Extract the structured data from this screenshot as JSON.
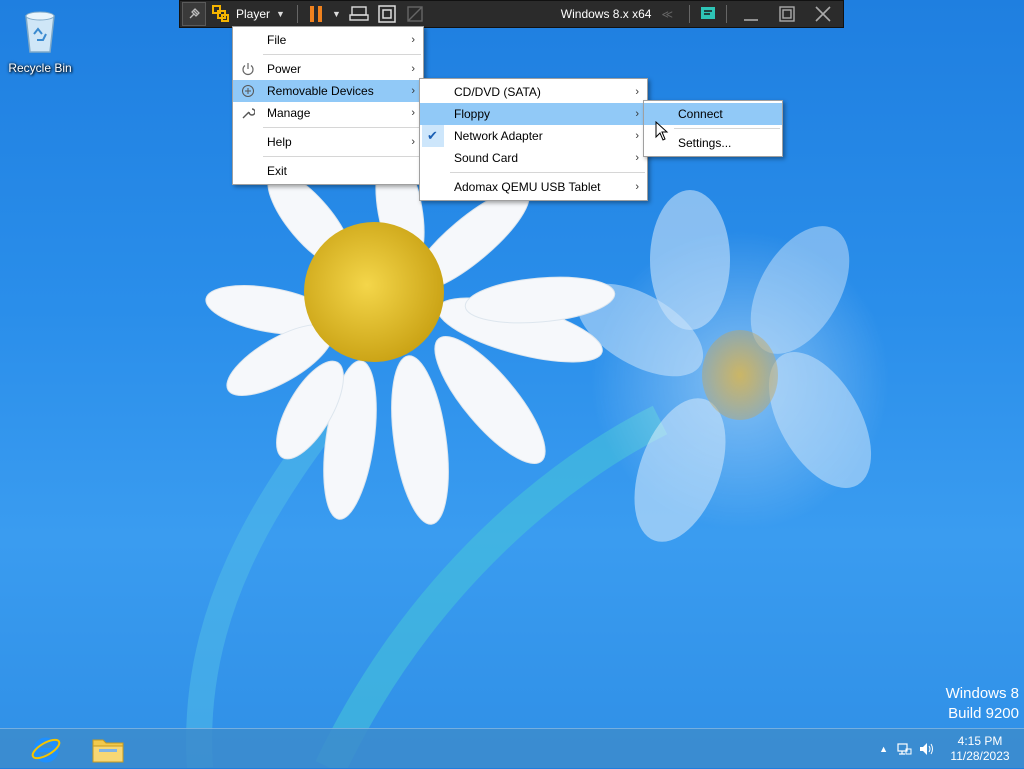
{
  "desktop": {
    "recycle_bin_label": "Recycle Bin"
  },
  "toolbar": {
    "player_label": "Player",
    "vm_name": "Windows 8.x x64",
    "icons": [
      "pin-icon",
      "player-logo-icon",
      "pause-icon",
      "send-ctrl-alt-del-icon",
      "fit-guest-icon",
      "unity-icon",
      "message-log-icon",
      "minimize-icon",
      "restore-icon",
      "close-icon"
    ]
  },
  "main_menu": {
    "items": [
      {
        "label": "File"
      },
      {
        "label": "Power"
      },
      {
        "label": "Removable Devices"
      },
      {
        "label": "Manage"
      },
      {
        "label": "Help"
      },
      {
        "label": "Exit"
      }
    ]
  },
  "devices_menu": {
    "items": [
      {
        "label": "CD/DVD (SATA)"
      },
      {
        "label": "Floppy"
      },
      {
        "label": "Network Adapter"
      },
      {
        "label": "Sound Card"
      },
      {
        "label": "Adomax QEMU USB Tablet"
      }
    ]
  },
  "floppy_menu": {
    "items": [
      {
        "label": "Connect"
      },
      {
        "label": "Settings..."
      }
    ]
  },
  "watermark": {
    "line1": "Windows 8",
    "line2": "Build 9200"
  },
  "taskbar": {
    "time": "4:15 PM",
    "date": "11/28/2023"
  },
  "colors": {
    "highlight": "#91c9f7",
    "toolbar_bg": "#2b2b2b",
    "pause_orange": "#f0821e",
    "desktop_blue": "#2a8eea"
  }
}
